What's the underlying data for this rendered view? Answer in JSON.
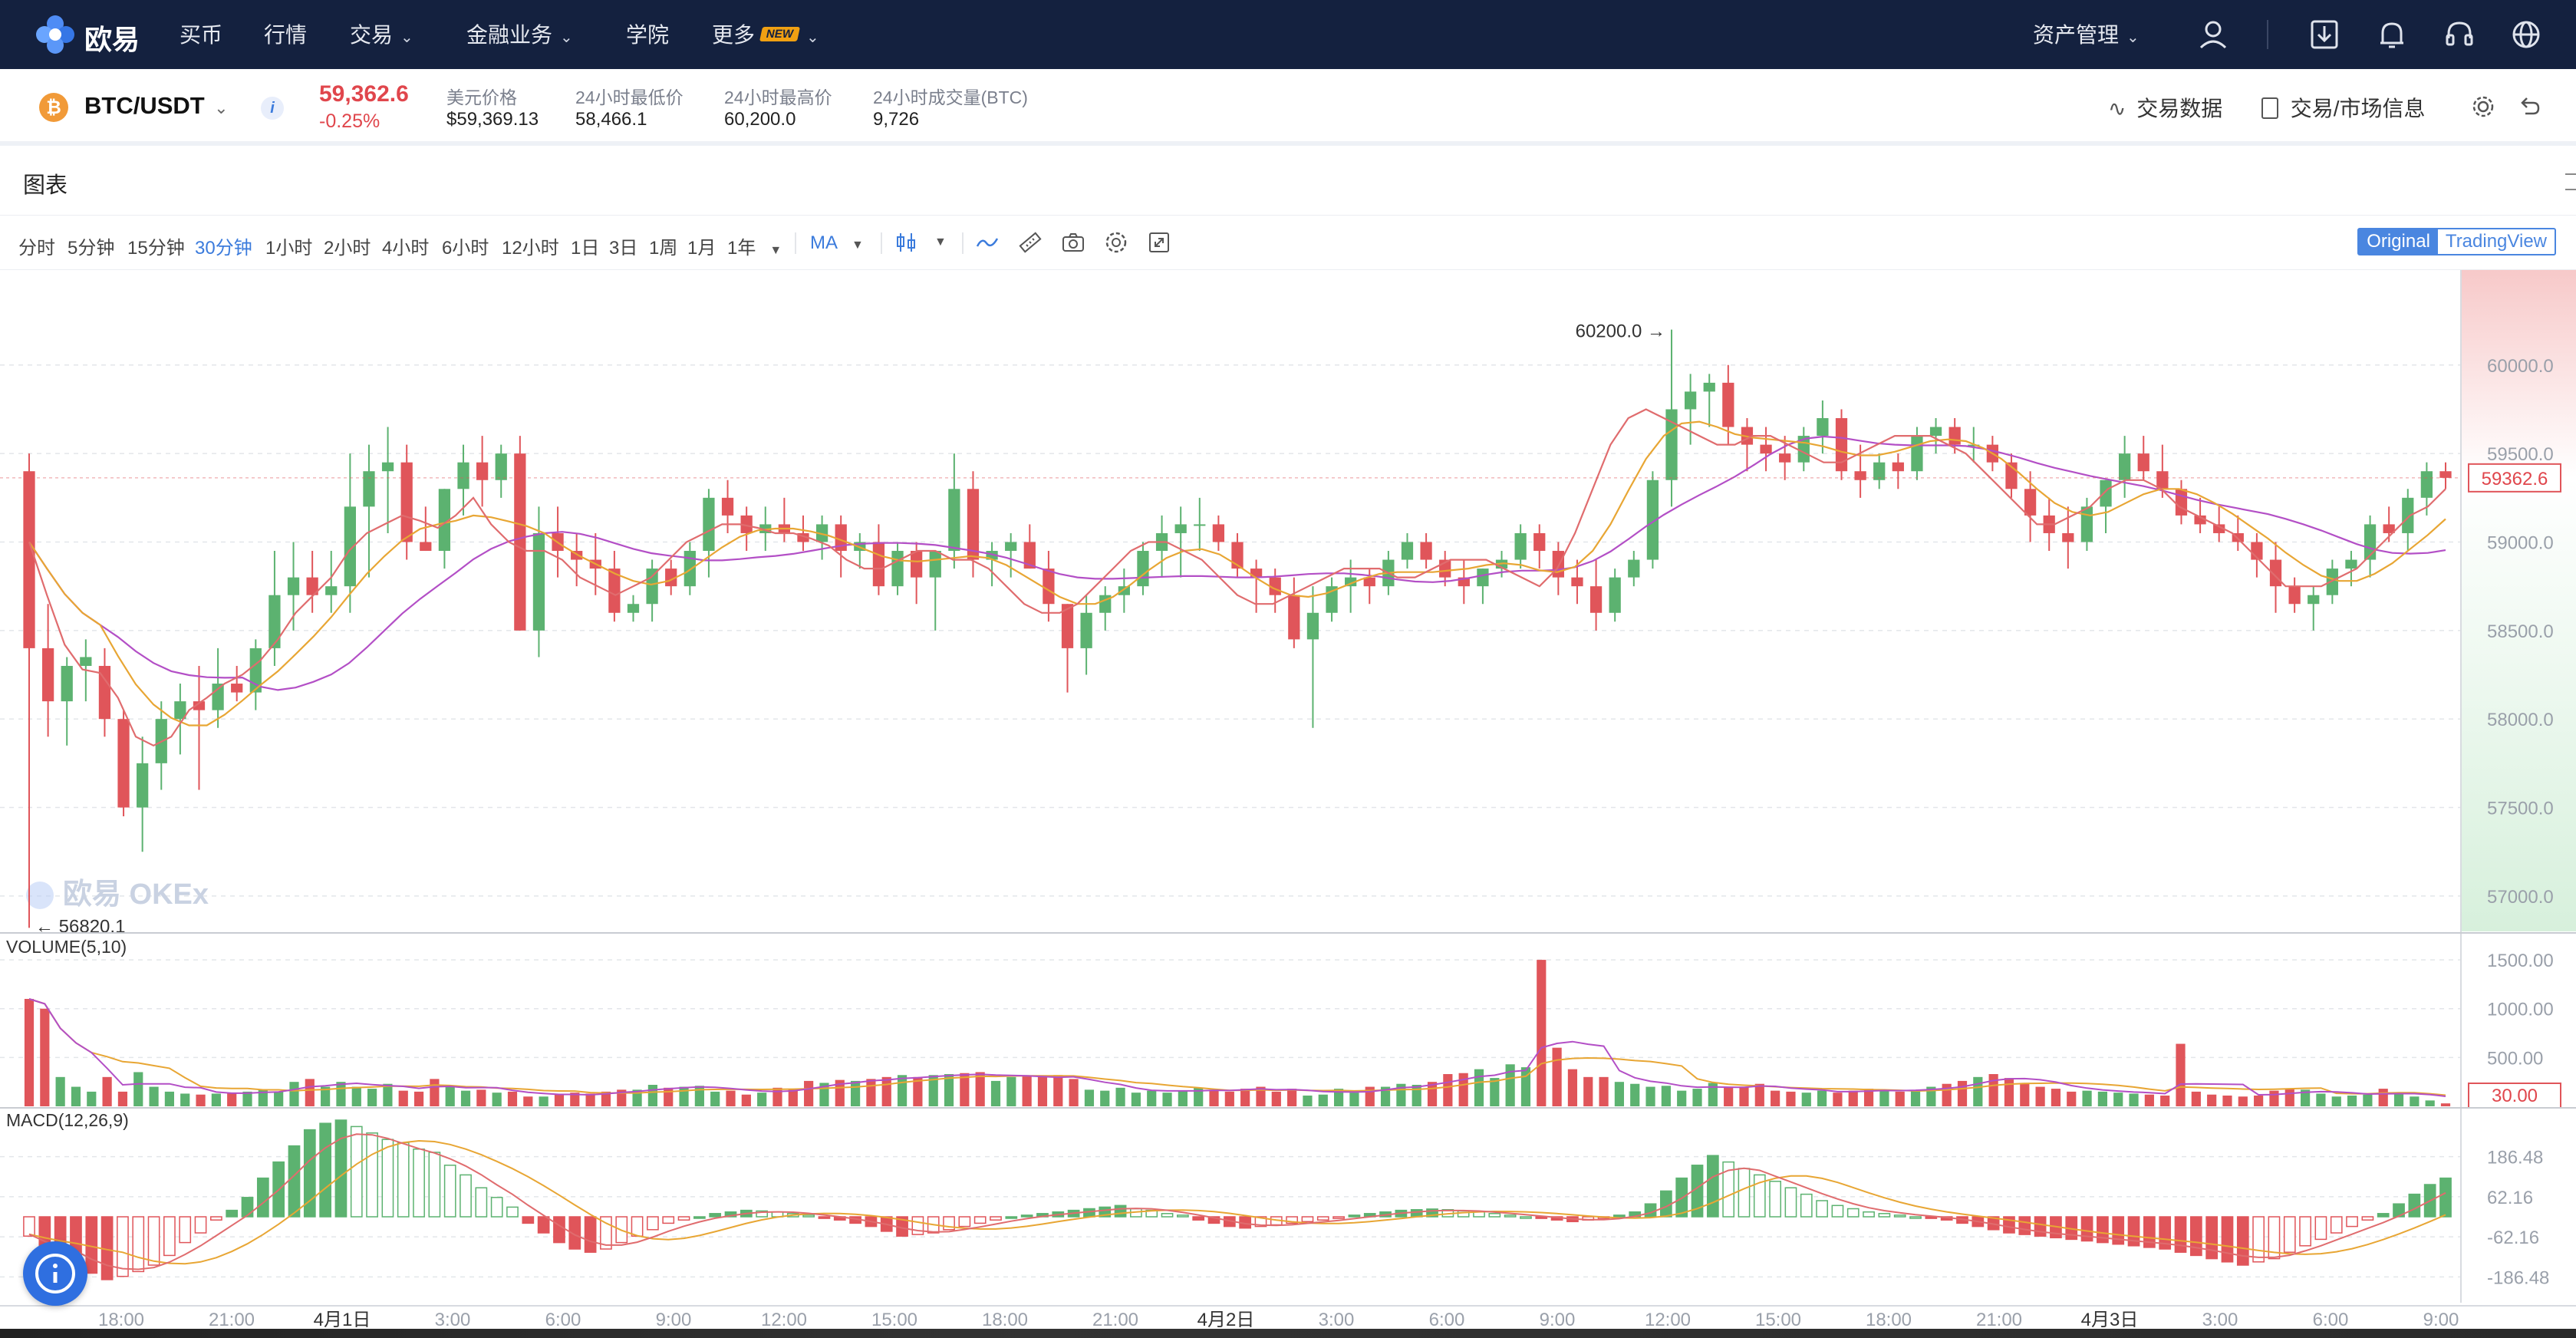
{
  "nav": {
    "brand": "欧易",
    "items": [
      "买币",
      "行情",
      "交易",
      "金融业务",
      "学院",
      "更多"
    ],
    "new_badge": "NEW",
    "asset_menu": "资产管理"
  },
  "ticker": {
    "pair": "BTC/USDT",
    "price": "59,362.6",
    "change": "-0.25%",
    "usd_label": "美元价格",
    "usd_value": "$59,369.13",
    "low_label": "24小时最低价",
    "low_value": "58,466.1",
    "high_label": "24小时最高价",
    "high_value": "60,200.0",
    "vol_label": "24小时成交量(BTC)",
    "vol_value": "9,726",
    "trade_data": "交易数据",
    "market_info": "交易/市场信息"
  },
  "panel": {
    "title": "图表",
    "timeframes": [
      "分时",
      "5分钟",
      "15分钟",
      "30分钟",
      "1小时",
      "2小时",
      "4小时",
      "6小时",
      "12小时",
      "1日",
      "3日",
      "1周",
      "1月",
      "1年"
    ],
    "active_timeframe": "30分钟",
    "indicator": "MA",
    "view_original": "Original",
    "view_tradingview": "TradingView"
  },
  "chart_data": {
    "type": "candlestick",
    "price_axis": {
      "ticks": [
        "60000.0",
        "59500.0",
        "59000.0",
        "58500.0",
        "58000.0",
        "57500.0",
        "57000.0"
      ],
      "range": [
        56800,
        60450
      ]
    },
    "time_axis": [
      "18:00",
      "21:00",
      "4月1日",
      "3:00",
      "6:00",
      "9:00",
      "12:00",
      "15:00",
      "18:00",
      "21:00",
      "4月2日",
      "3:00",
      "6:00",
      "9:00",
      "12:00",
      "15:00",
      "18:00",
      "21:00",
      "4月3日",
      "3:00",
      "6:00",
      "9:00"
    ],
    "high_marker": "60200.0",
    "low_marker": "56820.1",
    "last_price": "59362.6",
    "watermark": "欧易 OKEx",
    "series_colors": {
      "up": "#5cb270",
      "down": "#e0555a",
      "ma_fast": "#e06c6e",
      "ma_mid": "#e8a634",
      "ma_slow": "#b34fc6"
    },
    "candles": [
      [
        59400,
        59500,
        56820,
        58400
      ],
      [
        58400,
        58650,
        57900,
        58100
      ],
      [
        58100,
        58350,
        57850,
        58300
      ],
      [
        58300,
        58450,
        58100,
        58350
      ],
      [
        58300,
        58400,
        57900,
        58000
      ],
      [
        58000,
        58050,
        57450,
        57500
      ],
      [
        57500,
        57900,
        57250,
        57750
      ],
      [
        57750,
        58100,
        57600,
        58000
      ],
      [
        58000,
        58200,
        57800,
        58100
      ],
      [
        58100,
        58300,
        57600,
        58050
      ],
      [
        58050,
        58400,
        57950,
        58200
      ],
      [
        58200,
        58300,
        58100,
        58150
      ],
      [
        58150,
        58450,
        58050,
        58400
      ],
      [
        58400,
        58950,
        58300,
        58700
      ],
      [
        58700,
        59000,
        58500,
        58800
      ],
      [
        58800,
        58950,
        58600,
        58700
      ],
      [
        58700,
        58950,
        58600,
        58750
      ],
      [
        58750,
        59500,
        58600,
        59200
      ],
      [
        59200,
        59550,
        58800,
        59400
      ],
      [
        59400,
        59650,
        59050,
        59450
      ],
      [
        59450,
        59550,
        58900,
        59000
      ],
      [
        59000,
        59200,
        58950,
        58950
      ],
      [
        58950,
        59300,
        58850,
        59300
      ],
      [
        59300,
        59550,
        59150,
        59450
      ],
      [
        59450,
        59600,
        59200,
        59350
      ],
      [
        59350,
        59550,
        59250,
        59500
      ],
      [
        59500,
        59600,
        58500,
        58500
      ],
      [
        58500,
        59200,
        58350,
        59050
      ],
      [
        59050,
        59200,
        58800,
        58950
      ],
      [
        58950,
        59050,
        58750,
        58900
      ],
      [
        58900,
        59050,
        58700,
        58850
      ],
      [
        58850,
        58950,
        58550,
        58600
      ],
      [
        58600,
        58700,
        58550,
        58650
      ],
      [
        58650,
        58900,
        58550,
        58850
      ],
      [
        58850,
        58900,
        58700,
        58750
      ],
      [
        58750,
        59000,
        58700,
        58950
      ],
      [
        58950,
        59300,
        58800,
        59250
      ],
      [
        59250,
        59350,
        59050,
        59150
      ],
      [
        59150,
        59200,
        58950,
        59050
      ],
      [
        59050,
        59200,
        58950,
        59100
      ],
      [
        59100,
        59250,
        59000,
        59050
      ],
      [
        59050,
        59150,
        58950,
        59000
      ],
      [
        59000,
        59150,
        58900,
        59100
      ],
      [
        59100,
        59150,
        58800,
        58950
      ],
      [
        58950,
        59050,
        58850,
        59000
      ],
      [
        59000,
        59100,
        58700,
        58750
      ],
      [
        58750,
        59000,
        58700,
        58950
      ],
      [
        58950,
        59000,
        58650,
        58800
      ],
      [
        58800,
        58950,
        58500,
        58950
      ],
      [
        58950,
        59500,
        58850,
        59300
      ],
      [
        59300,
        59400,
        58800,
        58900
      ],
      [
        58900,
        59000,
        58750,
        58950
      ],
      [
        58950,
        59050,
        58800,
        59000
      ],
      [
        59000,
        59100,
        58850,
        58850
      ],
      [
        58850,
        58950,
        58550,
        58650
      ],
      [
        58650,
        58650,
        58150,
        58400
      ],
      [
        58400,
        58700,
        58250,
        58600
      ],
      [
        58600,
        58750,
        58500,
        58700
      ],
      [
        58700,
        58850,
        58600,
        58750
      ],
      [
        58750,
        59000,
        58700,
        58950
      ],
      [
        58950,
        59150,
        58800,
        59050
      ],
      [
        59050,
        59200,
        58800,
        59100
      ],
      [
        59100,
        59250,
        58950,
        59100
      ],
      [
        59100,
        59150,
        58950,
        59000
      ],
      [
        59000,
        59050,
        58800,
        58850
      ],
      [
        58850,
        58900,
        58600,
        58800
      ],
      [
        58800,
        58850,
        58600,
        58700
      ],
      [
        58700,
        58800,
        58400,
        58450
      ],
      [
        58450,
        58750,
        57950,
        58600
      ],
      [
        58600,
        58800,
        58550,
        58750
      ],
      [
        58750,
        58900,
        58600,
        58800
      ],
      [
        58800,
        58850,
        58650,
        58750
      ],
      [
        58750,
        58950,
        58700,
        58900
      ],
      [
        58900,
        59050,
        58850,
        59000
      ],
      [
        59000,
        59050,
        58850,
        58900
      ],
      [
        58900,
        58950,
        58750,
        58800
      ],
      [
        58800,
        58900,
        58650,
        58750
      ],
      [
        58750,
        58850,
        58650,
        58850
      ],
      [
        58850,
        58950,
        58800,
        58900
      ],
      [
        58900,
        59100,
        58850,
        59050
      ],
      [
        59050,
        59100,
        58850,
        58950
      ],
      [
        58950,
        59000,
        58700,
        58800
      ],
      [
        58800,
        58900,
        58650,
        58750
      ],
      [
        58750,
        58900,
        58500,
        58600
      ],
      [
        58600,
        58850,
        58550,
        58800
      ],
      [
        58800,
        58950,
        58750,
        58900
      ],
      [
        58900,
        59400,
        58850,
        59350
      ],
      [
        59350,
        60200,
        59200,
        59750
      ],
      [
        59750,
        59950,
        59550,
        59850
      ],
      [
        59850,
        59950,
        59650,
        59900
      ],
      [
        59900,
        60000,
        59550,
        59650
      ],
      [
        59650,
        59700,
        59400,
        59550
      ],
      [
        59550,
        59650,
        59400,
        59500
      ],
      [
        59500,
        59600,
        59350,
        59450
      ],
      [
        59450,
        59650,
        59400,
        59600
      ],
      [
        59600,
        59800,
        59500,
        59700
      ],
      [
        59700,
        59750,
        59350,
        59400
      ],
      [
        59400,
        59550,
        59250,
        59350
      ],
      [
        59350,
        59500,
        59300,
        59450
      ],
      [
        59450,
        59500,
        59300,
        59400
      ],
      [
        59400,
        59650,
        59350,
        59600
      ],
      [
        59600,
        59700,
        59500,
        59650
      ],
      [
        59650,
        59700,
        59500,
        59550
      ],
      [
        59550,
        59650,
        59450,
        59550
      ],
      [
        59550,
        59600,
        59400,
        59450
      ],
      [
        59450,
        59500,
        59250,
        59300
      ],
      [
        59300,
        59400,
        59000,
        59150
      ],
      [
        59150,
        59250,
        58950,
        59050
      ],
      [
        59050,
        59200,
        58850,
        59000
      ],
      [
        59000,
        59250,
        58950,
        59200
      ],
      [
        59200,
        59350,
        59050,
        59350
      ],
      [
        59350,
        59600,
        59250,
        59500
      ],
      [
        59500,
        59600,
        59350,
        59400
      ],
      [
        59400,
        59550,
        59250,
        59300
      ],
      [
        59300,
        59350,
        59100,
        59150
      ],
      [
        59150,
        59250,
        59050,
        59100
      ],
      [
        59100,
        59200,
        59000,
        59050
      ],
      [
        59050,
        59150,
        58950,
        59000
      ],
      [
        59000,
        59050,
        58800,
        58900
      ],
      [
        58900,
        59000,
        58600,
        58750
      ],
      [
        58750,
        58800,
        58600,
        58650
      ],
      [
        58650,
        58750,
        58500,
        58700
      ],
      [
        58700,
        58900,
        58650,
        58850
      ],
      [
        58850,
        58950,
        58750,
        58900
      ],
      [
        58900,
        59150,
        58800,
        59100
      ],
      [
        59100,
        59200,
        59000,
        59050
      ],
      [
        59050,
        59300,
        58950,
        59250
      ],
      [
        59250,
        59450,
        59150,
        59400
      ],
      [
        59400,
        59450,
        59300,
        59362.6
      ]
    ],
    "ma_fast": [
      59000,
      58700,
      58420,
      58280,
      58260,
      58120,
      57900,
      57850,
      57900,
      58050,
      58120,
      58200,
      58250,
      58330,
      58450,
      58600,
      58700,
      58800,
      58950,
      59050,
      59100,
      59150,
      59120,
      59080,
      59150,
      59250,
      59100,
      59000,
      58950,
      58950,
      58900,
      58800,
      58750,
      58700,
      58750,
      58800,
      58900,
      59000,
      59050,
      59100,
      59100,
      59080,
      59050,
      59050,
      59020,
      58980,
      58900,
      58850,
      58850,
      58900,
      58950,
      58950,
      58900,
      58900,
      58850,
      58750,
      58650,
      58600,
      58600,
      58650,
      58750,
      58850,
      58950,
      59000,
      59000,
      58950,
      58900,
      58800,
      58700,
      58650,
      58650,
      58700,
      58750,
      58800,
      58850,
      58850,
      58850,
      58800,
      58800,
      58850,
      58900,
      58900,
      58900,
      58850,
      58800,
      58750,
      58850,
      59050,
      59300,
      59550,
      59700,
      59750,
      59700,
      59650,
      59600,
      59550,
      59550,
      59600,
      59600,
      59550,
      59500,
      59450,
      59450,
      59500,
      59550,
      59600,
      59600,
      59600,
      59550,
      59500,
      59400,
      59300,
      59200,
      59100,
      59100,
      59150,
      59200,
      59300,
      59350,
      59350,
      59300,
      59200,
      59150,
      59100,
      59050,
      58950,
      58850,
      58750,
      58750,
      58750,
      58800,
      58850,
      58950,
      59050,
      59150,
      59200,
      59300
    ]
  },
  "volume_panel": {
    "label": "VOLUME(5,10)",
    "ticks": [
      "1500.00",
      "1000.00",
      "500.00"
    ],
    "current": "30.00",
    "values": [
      1100,
      1000,
      300,
      200,
      150,
      300,
      150,
      350,
      200,
      150,
      130,
      120,
      130,
      140,
      150,
      170,
      150,
      250,
      280,
      200,
      250,
      200,
      180,
      230,
      160,
      150,
      280,
      200,
      160,
      170,
      140,
      150,
      100,
      100,
      120,
      140,
      130,
      150,
      170,
      170,
      220,
      190,
      200,
      210,
      150,
      160,
      120,
      140,
      190,
      180,
      260,
      240,
      270,
      260,
      280,
      300,
      320,
      300,
      320,
      330,
      340,
      350,
      260,
      300,
      310,
      300,
      320,
      280,
      170,
      160,
      190,
      140,
      160,
      140,
      160,
      190,
      170,
      150,
      180,
      200,
      150,
      180,
      110,
      120,
      180,
      140,
      200,
      200,
      230,
      220,
      250,
      330,
      340,
      380,
      290,
      430,
      400,
      1500,
      600,
      380,
      300,
      300,
      250,
      230,
      200,
      210,
      160,
      180,
      240,
      190,
      200,
      230,
      160,
      150,
      140,
      160,
      140,
      160,
      180,
      170,
      150,
      160,
      200,
      230,
      260,
      300,
      330,
      290,
      240,
      200,
      180,
      150,
      160,
      150,
      140,
      130,
      120,
      110,
      640,
      150,
      120,
      110,
      100,
      110,
      160,
      180,
      170,
      130,
      100,
      110,
      120,
      180,
      140,
      100,
      60,
      30
    ]
  },
  "macd_panel": {
    "label": "MACD(12,26,9)",
    "ticks": [
      "186.48",
      "62.16",
      "-62.16",
      "-186.48"
    ],
    "hist": [
      -60,
      -110,
      -140,
      -160,
      -175,
      -195,
      -185,
      -170,
      -150,
      -120,
      -80,
      -50,
      -10,
      20,
      60,
      120,
      170,
      220,
      270,
      290,
      300,
      280,
      260,
      240,
      230,
      210,
      200,
      160,
      130,
      90,
      60,
      30,
      -20,
      -50,
      -80,
      -100,
      -110,
      -100,
      -80,
      -60,
      -40,
      -20,
      -10,
      0,
      10,
      15,
      20,
      18,
      15,
      10,
      5,
      -5,
      -10,
      -20,
      -30,
      -45,
      -60,
      -55,
      -50,
      -40,
      -30,
      -20,
      -10,
      0,
      5,
      10,
      15,
      20,
      25,
      30,
      35,
      25,
      20,
      10,
      5,
      -10,
      -20,
      -30,
      -35,
      -30,
      -25,
      -20,
      -15,
      -10,
      -5,
      5,
      10,
      15,
      20,
      22,
      24,
      22,
      18,
      15,
      10,
      5,
      0,
      -5,
      -10,
      -15,
      -10,
      -5,
      5,
      15,
      40,
      80,
      120,
      160,
      190,
      170,
      150,
      130,
      110,
      90,
      70,
      50,
      35,
      25,
      15,
      10,
      5,
      0,
      -5,
      -10,
      -20,
      -30,
      -40,
      -50,
      -55,
      -60,
      -65,
      -70,
      -75,
      -80,
      -85,
      -90,
      -95,
      -100,
      -110,
      -120,
      -130,
      -140,
      -150,
      -140,
      -130,
      -110,
      -90,
      -70,
      -50,
      -30,
      -10,
      10,
      40,
      70,
      100,
      120
    ]
  }
}
